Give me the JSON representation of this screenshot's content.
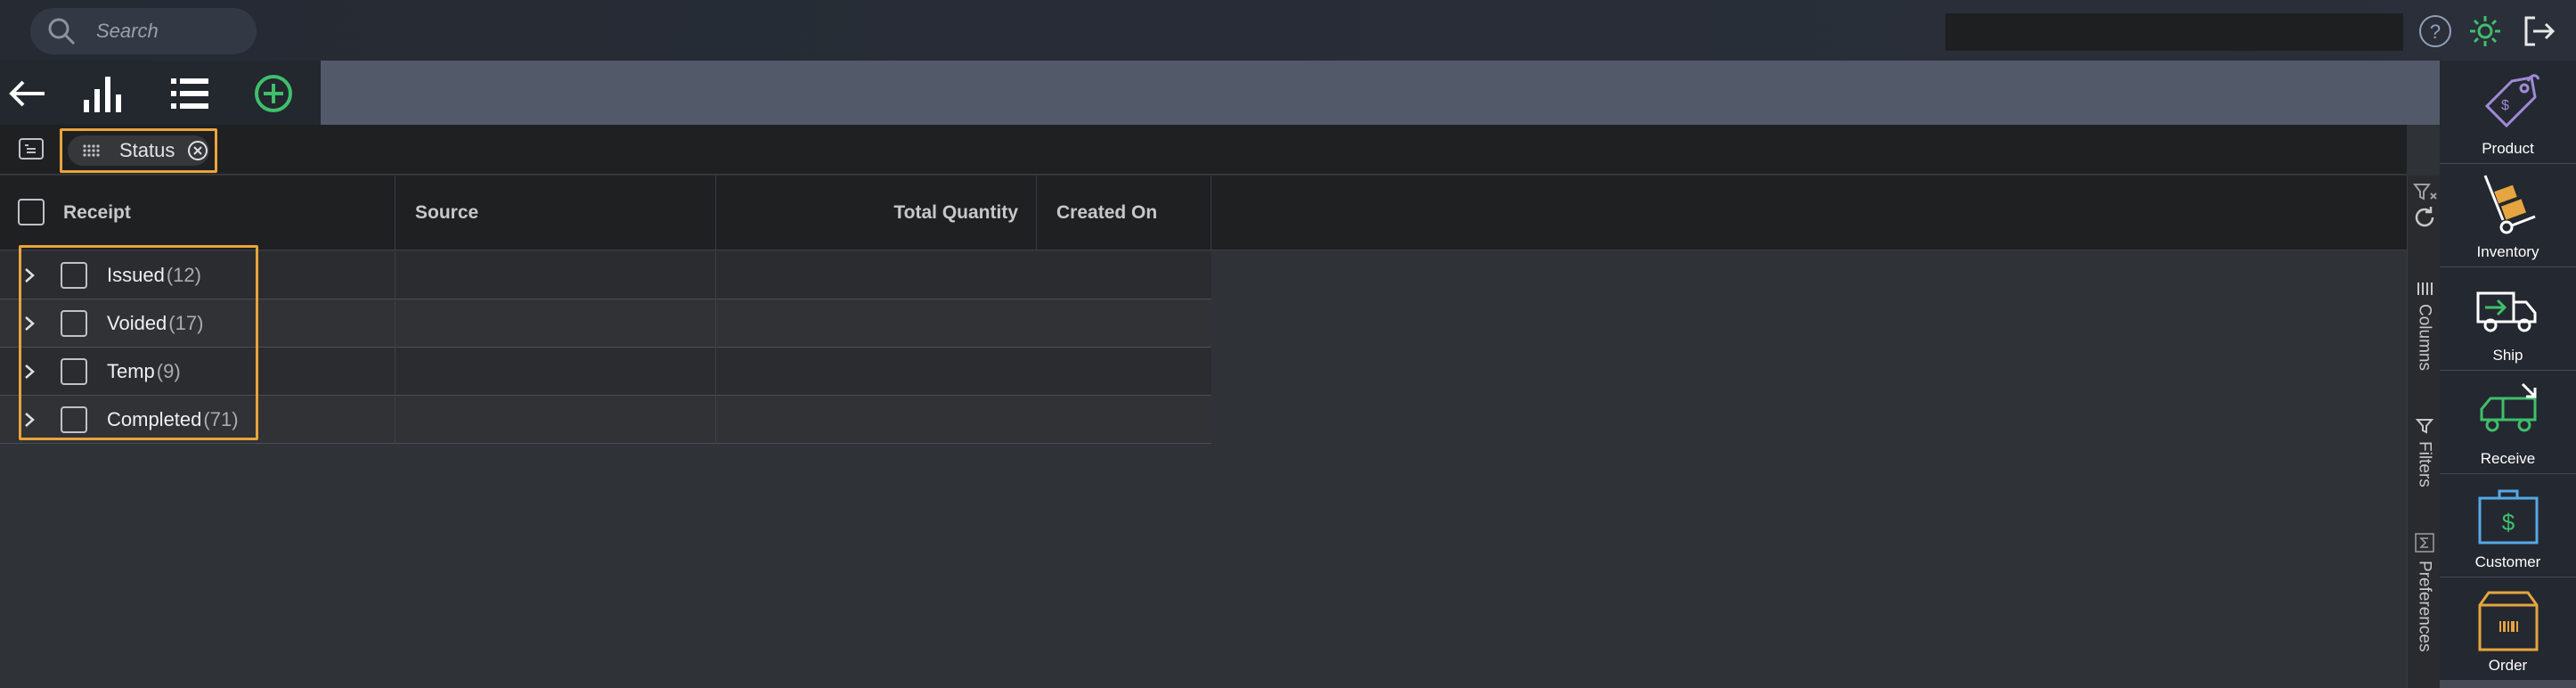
{
  "search": {
    "placeholder": "Search"
  },
  "toolbar": {
    "icons": [
      "back-arrow-icon",
      "bar-chart-icon",
      "list-icon",
      "add-circle-icon"
    ]
  },
  "grouping": {
    "chip_label": "Status"
  },
  "grid": {
    "columns": [
      "Receipt",
      "Source",
      "Total Quantity",
      "Created On"
    ],
    "groups": [
      {
        "label": "Issued",
        "count": "(12)"
      },
      {
        "label": "Voided",
        "count": "(17)"
      },
      {
        "label": "Temp",
        "count": "(9)"
      },
      {
        "label": "Completed",
        "count": "(71)"
      }
    ]
  },
  "side_panel": {
    "tabs": [
      "Columns",
      "Filters",
      "Preferences"
    ]
  },
  "nav": {
    "items": [
      "Product",
      "Inventory",
      "Ship",
      "Receive",
      "Customer",
      "Order"
    ]
  },
  "colors": {
    "accent_green": "#3fbf6c",
    "highlight_orange": "#e8a43b",
    "nav_purple": "#a08ad6",
    "nav_orange": "#e6a540",
    "nav_blue": "#56a8e6"
  }
}
